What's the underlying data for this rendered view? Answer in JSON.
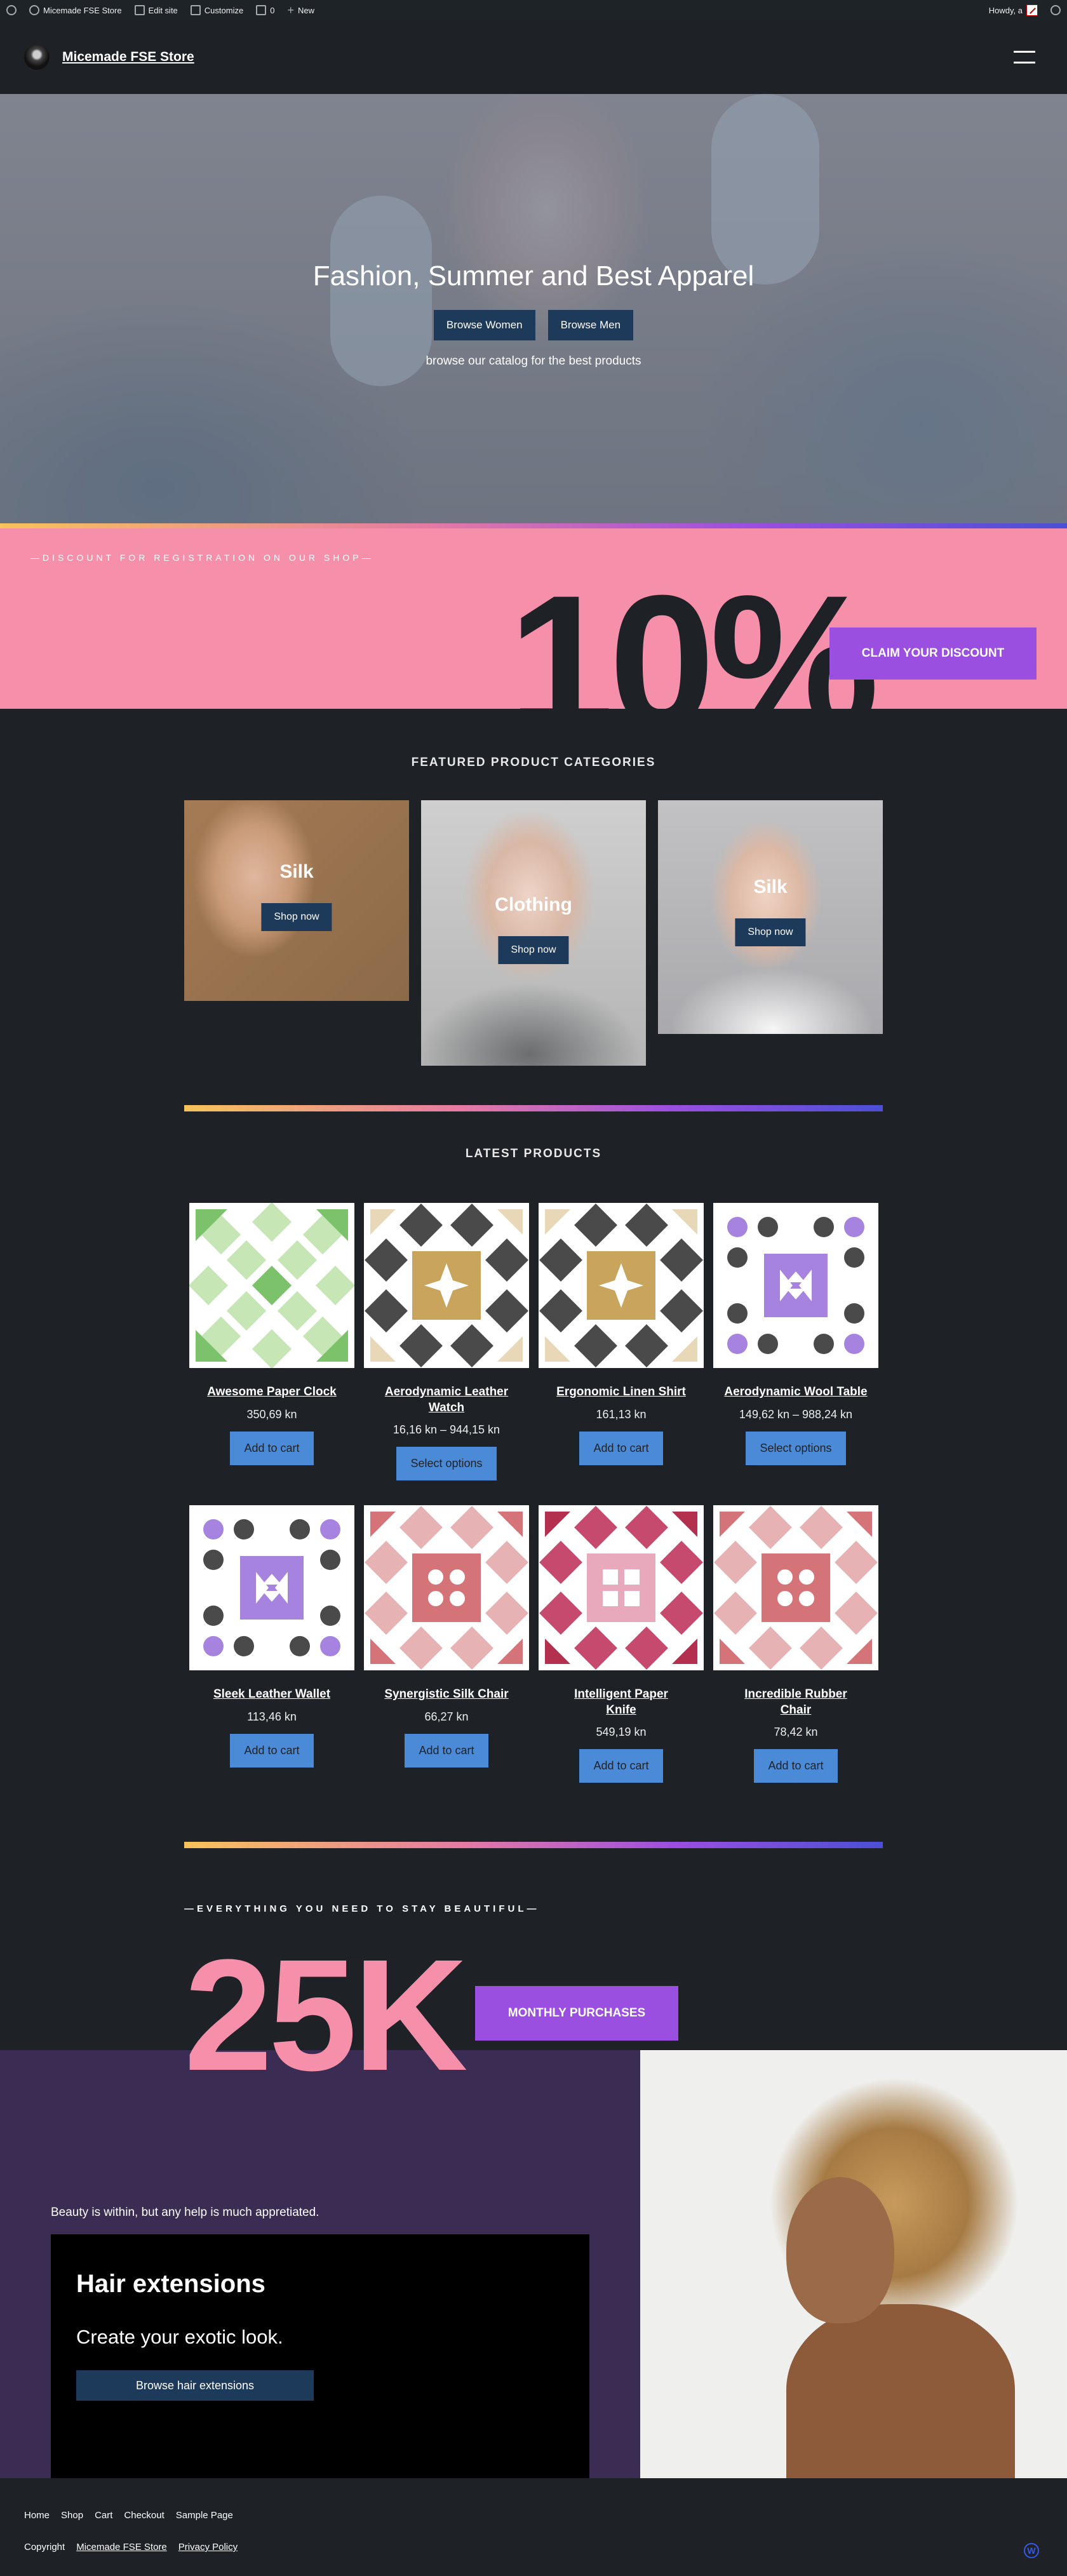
{
  "admin_bar": {
    "site_name": "Micemade FSE Store",
    "edit_site": "Edit site",
    "customize": "Customize",
    "comments_count": "0",
    "new": "New",
    "howdy": "Howdy, a"
  },
  "header": {
    "site_title": "Micemade FSE Store"
  },
  "hero": {
    "title": "Fashion, Summer and Best Apparel",
    "browse_women": "Browse Women",
    "browse_men": "Browse Men",
    "subtitle": "browse our catalog for the best products"
  },
  "discount": {
    "tagline": "—DISCOUNT FOR REGISTRATION ON OUR SHOP—",
    "amount": "10%",
    "button": "CLAIM YOUR DISCOUNT"
  },
  "featured": {
    "title": "FEATURED PRODUCT CATEGORIES",
    "categories": [
      {
        "label": "Silk",
        "button": "Shop now"
      },
      {
        "label": "Clothing",
        "button": "Shop now"
      },
      {
        "label": "Silk",
        "button": "Shop now"
      }
    ]
  },
  "latest": {
    "title": "LATEST PRODUCTS",
    "products": [
      {
        "name": "Awesome Paper Clock",
        "price": "350,69 kn",
        "button": "Add to cart",
        "pattern": "green"
      },
      {
        "name": "Aerodynamic Leather Watch",
        "price": "16,16 kn – 944,15 kn",
        "button": "Select options",
        "pattern": "gold"
      },
      {
        "name": "Ergonomic Linen Shirt",
        "price": "161,13 kn",
        "button": "Add to cart",
        "pattern": "gold"
      },
      {
        "name": "Aerodynamic Wool Table",
        "price": "149,62 kn – 988,24 kn",
        "button": "Select options",
        "pattern": "purple"
      },
      {
        "name": "Sleek Leather Wallet",
        "price": "113,46 kn",
        "button": "Add to cart",
        "pattern": "purple"
      },
      {
        "name": "Synergistic Silk Chair",
        "price": "66,27 kn",
        "button": "Add to cart",
        "pattern": "rose"
      },
      {
        "name": "Intelligent Paper Knife",
        "price": "549,19 kn",
        "button": "Add to cart",
        "pattern": "crimson"
      },
      {
        "name": "Incredible Rubber Chair",
        "price": "78,42 kn",
        "button": "Add to cart",
        "pattern": "rose"
      }
    ]
  },
  "stats": {
    "tagline": "—EVERYTHING YOU NEED TO STAY BEAUTIFUL—",
    "number": "25K",
    "button": "MONTHLY PURCHASES"
  },
  "promo": {
    "text": "Beauty is within, but any help is much appretiated.",
    "title": "Hair extensions",
    "subtitle": "Create your exotic look.",
    "button": "Browse hair extensions"
  },
  "footer": {
    "nav": [
      "Home",
      "Shop",
      "Cart",
      "Checkout",
      "Sample Page"
    ],
    "copyright": "Copyright",
    "site_link": "Micemade FSE Store",
    "privacy": "Privacy Policy"
  },
  "colors": {
    "background": "#1e2227",
    "pink": "#f68fa9",
    "purple": "#9b4fe0",
    "navy_button": "#1e3a5a",
    "blue_button": "#4b8ad6",
    "promo_purple": "#3a2c52"
  }
}
